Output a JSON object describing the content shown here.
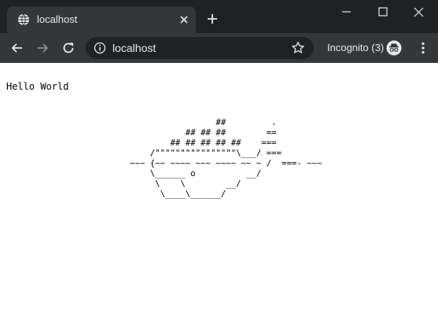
{
  "browser": {
    "tab": {
      "title": "localhost",
      "favicon": "globe-icon"
    },
    "new_tab_icon": "plus-icon",
    "window_controls": [
      "minimize-icon",
      "maximize-icon",
      "close-icon"
    ],
    "toolbar": {
      "back_icon": "arrow-left-icon",
      "forward_icon": "arrow-right-icon",
      "reload_icon": "reload-icon",
      "address": "localhost",
      "site_info_icon": "info-icon",
      "bookmark_icon": "star-icon",
      "incognito_label": "Incognito (3)",
      "incognito_icon": "incognito-icon",
      "menu_icon": "kebab-menu-icon"
    }
  },
  "page": {
    "text": "Hello World",
    "ascii_art": "                 ##         .\n           ## ## ##        ==\n        ## ## ## ## ##    ===\n    /\"\"\"\"\"\"\"\"\"\"\"\"\"\"\"\"\\___/ ===\n~~~ {~~ ~~~~ ~~~ ~~~~ ~~ ~ /  ===- ~~~\n    \\______ o          __/\n     \\    \\        __/\n      \\____\\______/"
  },
  "colors": {
    "frame": "#202124",
    "toolbar": "#35363a",
    "text_light": "#e8eaed",
    "page_bg": "#ffffff"
  }
}
